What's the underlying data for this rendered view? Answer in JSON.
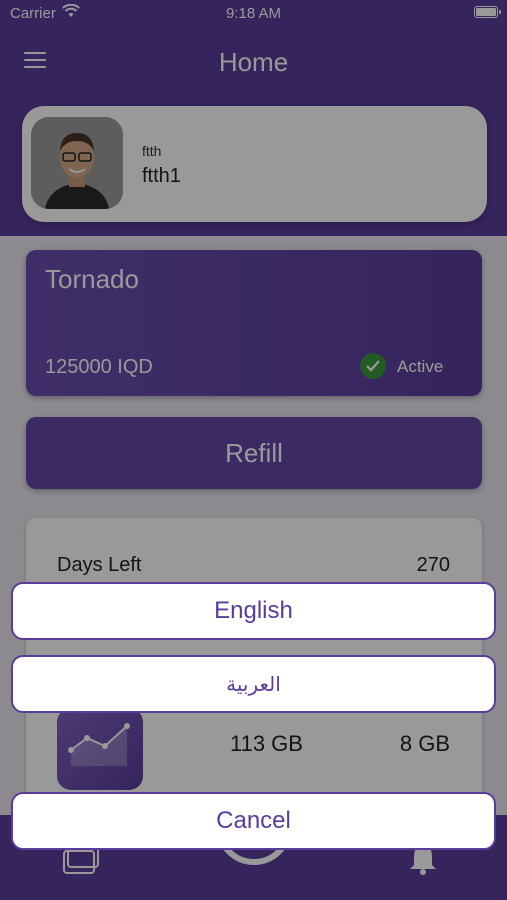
{
  "status_bar": {
    "carrier": "Carrier",
    "time": "9:18 AM"
  },
  "header": {
    "title": "Home"
  },
  "profile": {
    "username_small": "ftth",
    "username": "ftth1"
  },
  "plan": {
    "name": "Tornado",
    "price": "125000 IQD",
    "status": "Active"
  },
  "refill": {
    "label": "Refill"
  },
  "stats": {
    "days_left_label": "Days Left",
    "days_left_value": "270",
    "usage_total": "113 GB",
    "usage_used": "8 GB"
  },
  "language_sheet": {
    "english": "English",
    "arabic": "العربية",
    "cancel": "Cancel"
  },
  "colors": {
    "primary": "#5a3d9a",
    "active": "#3b9a3b",
    "background": "#e9e7ee"
  }
}
